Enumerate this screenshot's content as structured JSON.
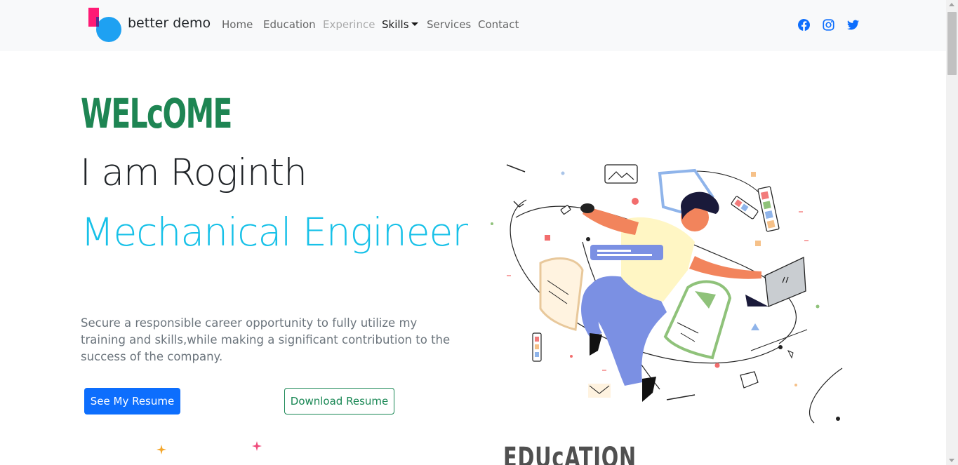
{
  "navbar": {
    "brand": "better demo",
    "links": [
      {
        "label": "Home",
        "state": "normal"
      },
      {
        "label": "Education",
        "state": "normal"
      },
      {
        "label": "Experince",
        "state": "disabled"
      },
      {
        "label": "Skills",
        "state": "dropdown"
      },
      {
        "label": "Services",
        "state": "normal"
      },
      {
        "label": "Contact",
        "state": "normal"
      }
    ],
    "social_icons": [
      "facebook-icon",
      "instagram-icon",
      "twitter-icon"
    ]
  },
  "hero": {
    "welcome": "WELcOME",
    "intro": "I am Roginth",
    "role": "Mechanical Engineer",
    "tagline": "Secure a responsible career opportunity to fully utilize my training and skills,while making a significant contribution to the success of the company.",
    "primary_button": "See My Resume",
    "secondary_button": "Download Resume"
  },
  "next_section": {
    "heading": "EDUcATION"
  },
  "colors": {
    "navbar_bg": "#f8f9fa",
    "welcome": "#1e8553",
    "role": "#17c1e8",
    "primary": "#0d6efd",
    "success": "#198754",
    "social": "#0d6efd",
    "logo_blue": "#1ea1f2",
    "logo_pink": "#ff1a75"
  }
}
